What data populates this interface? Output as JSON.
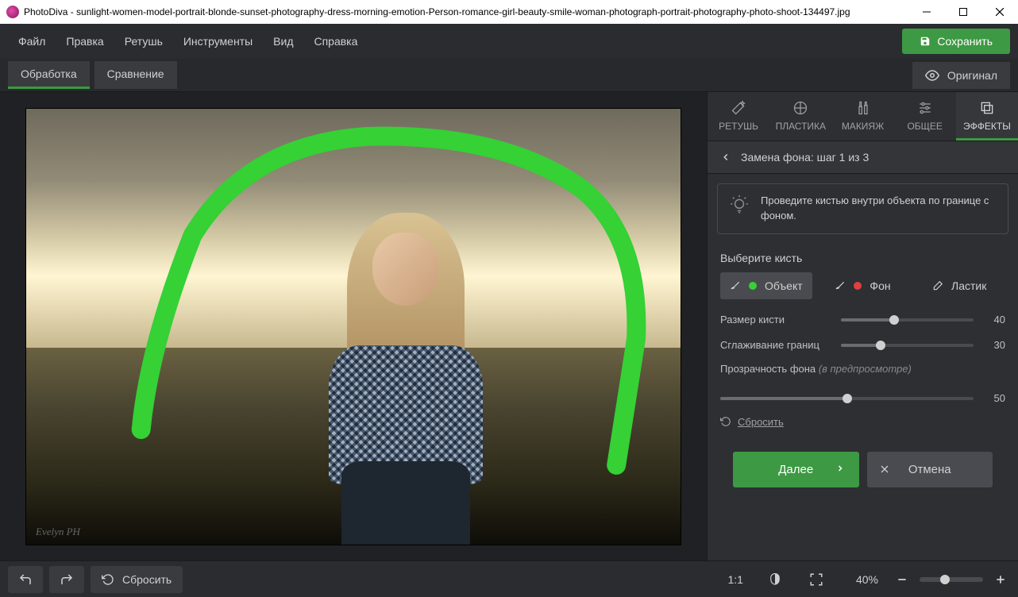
{
  "window": {
    "title": "PhotoDiva - sunlight-women-model-portrait-blonde-sunset-photography-dress-morning-emotion-Person-romance-girl-beauty-smile-woman-photograph-portrait-photography-photo-shoot-134497.jpg"
  },
  "menu": {
    "file": "Файл",
    "edit": "Правка",
    "retouch": "Ретушь",
    "tools": "Инструменты",
    "view": "Вид",
    "help": "Справка",
    "save": "Сохранить"
  },
  "viewTabs": {
    "process": "Обработка",
    "compare": "Сравнение",
    "original": "Оригинал"
  },
  "toolTabs": {
    "retouch": "РЕТУШЬ",
    "plastic": "ПЛАСТИКА",
    "makeup": "МАКИЯЖ",
    "general": "ОБЩЕЕ",
    "effects": "ЭФФЕКТЫ"
  },
  "step": {
    "header": "Замена фона: шаг 1 из 3",
    "hint": "Проведите кистью внутри объекта по границе с фоном."
  },
  "brush": {
    "label": "Выберите кисть",
    "object": "Объект",
    "background": "Фон",
    "eraser": "Ластик"
  },
  "sliders": {
    "size_label": "Размер кисти",
    "size_value": "40",
    "smooth_label": "Сглаживание границ",
    "smooth_value": "30",
    "opacity_label": "Прозрачность фона",
    "opacity_sub": "(в предпросмотре)",
    "opacity_value": "50"
  },
  "reset": "Сбросить",
  "nav": {
    "next": "Далее",
    "cancel": "Отмена"
  },
  "bottom": {
    "reset": "Сбросить",
    "ratio": "1:1",
    "zoom": "40%"
  },
  "watermark": "Evelyn PH"
}
